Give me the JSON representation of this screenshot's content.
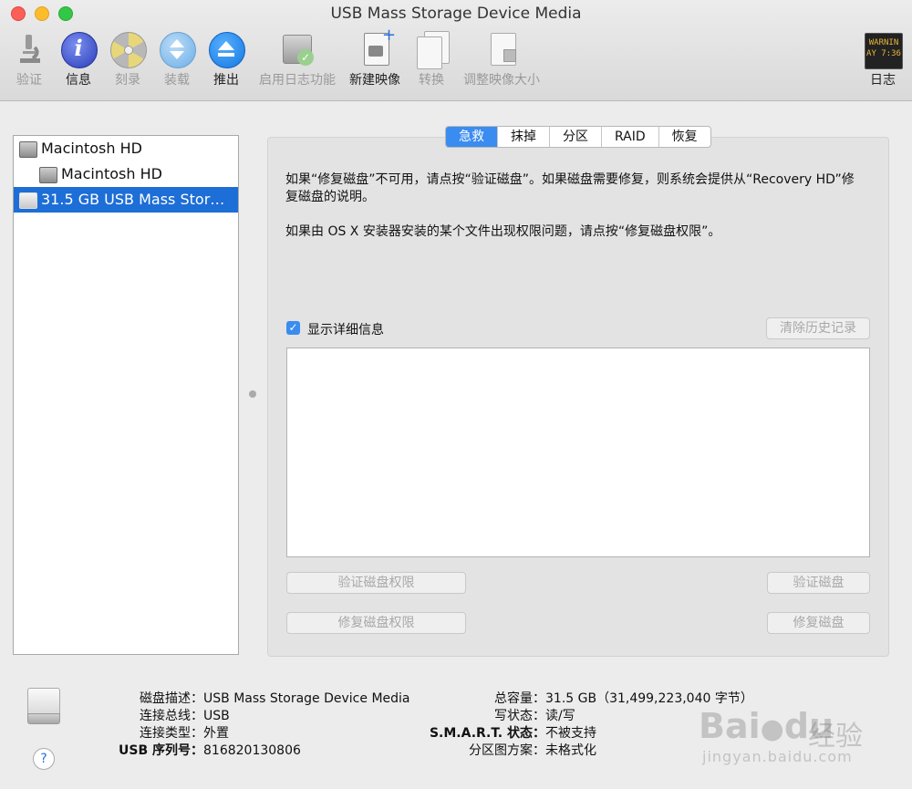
{
  "window": {
    "title": "USB Mass Storage Device Media"
  },
  "toolbar": {
    "items": [
      {
        "label": "验证",
        "enabled": false,
        "icon": "microscope-icon"
      },
      {
        "label": "信息",
        "enabled": true,
        "icon": "info-icon"
      },
      {
        "label": "刻录",
        "enabled": false,
        "icon": "burn-icon"
      },
      {
        "label": "装载",
        "enabled": false,
        "icon": "mount-icon"
      },
      {
        "label": "推出",
        "enabled": true,
        "icon": "eject-icon"
      },
      {
        "label": "启用日志功能",
        "enabled": false,
        "icon": "journal-icon"
      },
      {
        "label": "新建映像",
        "enabled": true,
        "icon": "new-image-icon"
      },
      {
        "label": "转换",
        "enabled": false,
        "icon": "convert-icon"
      },
      {
        "label": "调整映像大小",
        "enabled": false,
        "icon": "resize-image-icon"
      }
    ],
    "log": {
      "label": "日志",
      "icon_text_1": "WARNIN",
      "icon_text_2": "AY 7:36"
    }
  },
  "sidebar": {
    "items": [
      {
        "label": "Macintosh HD",
        "indent": 0,
        "selected": false
      },
      {
        "label": "Macintosh HD",
        "indent": 1,
        "selected": false
      },
      {
        "label": "31.5 GB USB Mass Stor…",
        "indent": 0,
        "selected": true
      }
    ]
  },
  "tabs": [
    {
      "label": "急救",
      "active": true
    },
    {
      "label": "抹掉",
      "active": false
    },
    {
      "label": "分区",
      "active": false
    },
    {
      "label": "RAID",
      "active": false
    },
    {
      "label": "恢复",
      "active": false
    }
  ],
  "firstaid": {
    "desc1": "如果“修复磁盘”不可用，请点按“验证磁盘”。如果磁盘需要修复，则系统会提供从“Recovery HD”修复磁盘的说明。",
    "desc2": "如果由 OS X 安装器安装的某个文件出现权限问题，请点按“修复磁盘权限”。",
    "show_details_label": "显示详细信息",
    "show_details_checked": true,
    "clear_history": "清除历史记录",
    "verify_permissions": "验证磁盘权限",
    "repair_permissions": "修复磁盘权限",
    "verify_disk": "验证磁盘",
    "repair_disk": "修复磁盘"
  },
  "footer": {
    "left": [
      {
        "k": "磁盘描述：",
        "v": "USB Mass Storage Device Media"
      },
      {
        "k": "连接总线：",
        "v": "USB"
      },
      {
        "k": "连接类型：",
        "v": "外置"
      },
      {
        "k": "USB 序列号：",
        "v": "816820130806"
      }
    ],
    "right": [
      {
        "k": "总容量：",
        "v": "31.5 GB（31,499,223,040 字节）"
      },
      {
        "k": "写状态：",
        "v": "读/写"
      },
      {
        "k": "S.M.A.R.T. 状态：",
        "v": "不被支持"
      },
      {
        "k": "分区图方案：",
        "v": "未格式化"
      }
    ],
    "help": "?"
  },
  "watermark": {
    "brand": "Bai",
    "brand2": "du",
    "cn": "经验",
    "url": "jingyan.baidu.com"
  }
}
